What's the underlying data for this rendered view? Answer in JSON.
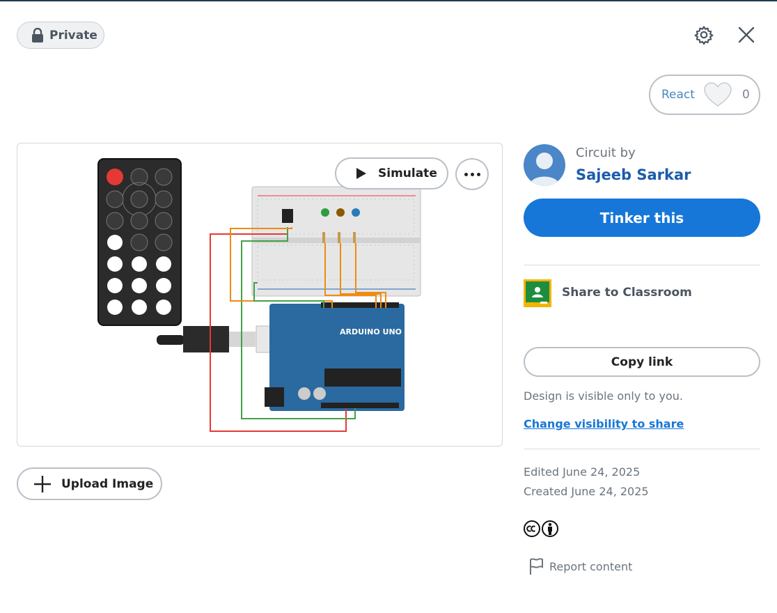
{
  "header": {
    "private_label": "Private",
    "react_label": "React",
    "react_count": "0"
  },
  "canvas": {
    "simulate_label": "Simulate"
  },
  "upload_label": "Upload Image",
  "author": {
    "circuit_by": "Circuit by",
    "name": "Sajeeb Sarkar"
  },
  "tinker_label": "Tinker this",
  "classroom_label": "Share to Classroom",
  "copy_link_label": "Copy link",
  "visibility_text": "Design is visible only to you.",
  "visibility_link": "Change visibility to share",
  "edited": "Edited June 24, 2025",
  "created": "Created June 24, 2025",
  "report_label": "Report content",
  "icons": {
    "lock": "lock-icon",
    "gear": "gear-icon",
    "close": "close-icon",
    "heart": "heart-icon",
    "play": "play-icon",
    "more": "more-icon",
    "plus": "plus-icon",
    "classroom": "google-classroom-icon",
    "cc": "creative-commons-icon",
    "flag": "flag-icon"
  },
  "colors": {
    "accent": "#1677d8",
    "author": "#1c5bab",
    "muted": "#6b747d"
  }
}
